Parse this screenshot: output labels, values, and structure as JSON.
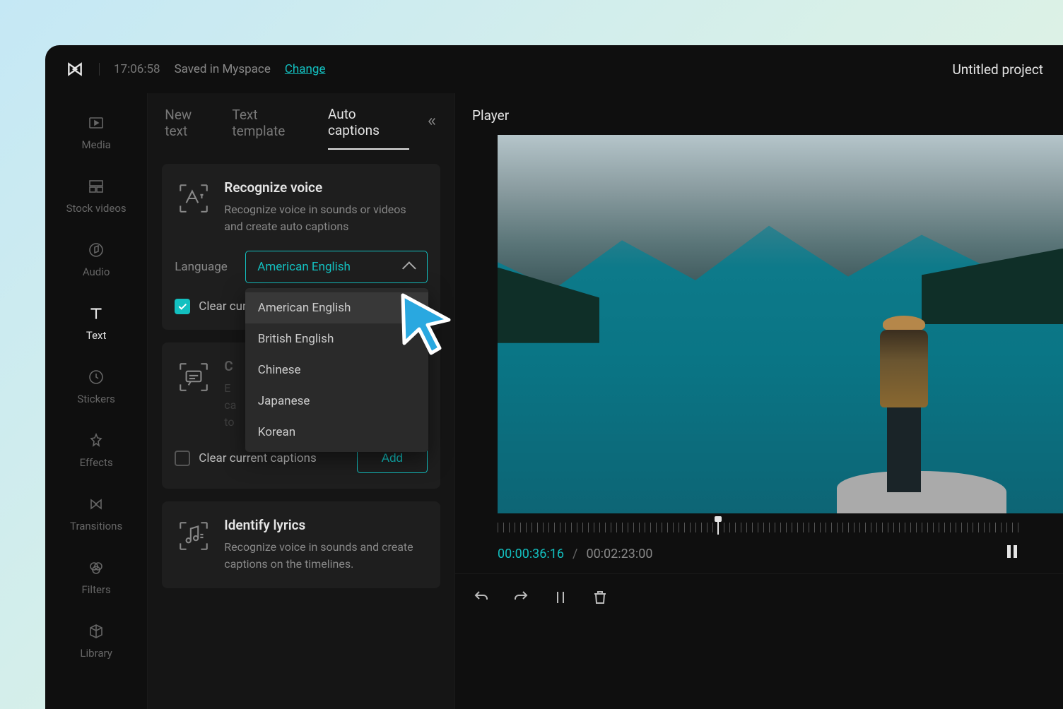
{
  "titlebar": {
    "timestamp": "17:06:58",
    "saved_text": "Saved in Myspace",
    "change_label": "Change",
    "project_title": "Untitled project"
  },
  "sidebar": {
    "items": [
      {
        "label": "Media"
      },
      {
        "label": "Stock videos"
      },
      {
        "label": "Audio"
      },
      {
        "label": "Text"
      },
      {
        "label": "Stickers"
      },
      {
        "label": "Effects"
      },
      {
        "label": "Transitions"
      },
      {
        "label": "Filters"
      },
      {
        "label": "Library"
      }
    ]
  },
  "tabs": {
    "new_text": "New text",
    "text_template": "Text template",
    "auto_captions": "Auto captions"
  },
  "recognize": {
    "title": "Recognize voice",
    "desc": "Recognize voice in sounds or videos and create auto captions",
    "language_label": "Language",
    "selected_language": "American English",
    "options": [
      "American English",
      "British English",
      "Chinese",
      "Japanese",
      "Korean"
    ],
    "clear_current_label": "Clear current captions"
  },
  "create": {
    "clear_current_label": "Clear current captions",
    "add_label": "Add"
  },
  "identify": {
    "title": "Identify lyrics",
    "desc": "Recognize voice in sounds and create captions on the timelines."
  },
  "player": {
    "label": "Player",
    "time_current": "00:00:36:16",
    "time_total": "00:02:23:00"
  }
}
